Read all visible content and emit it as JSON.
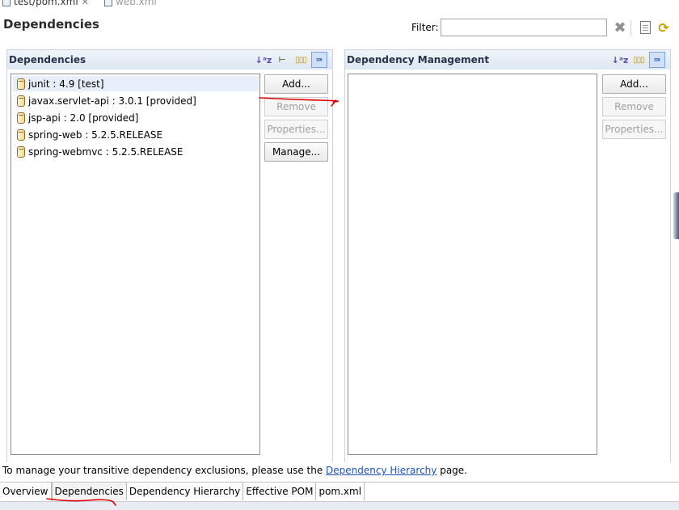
{
  "editor_tabs": [
    {
      "label": "test/pom.xml",
      "close": "✕"
    },
    {
      "label": "web.xml"
    }
  ],
  "page_title": "Dependencies",
  "filter": {
    "label": "Filter:",
    "value": ""
  },
  "icons": {
    "clear_filter": "clear-filter-icon",
    "show_pom": "pom-document-icon",
    "refresh": "refresh-icon"
  },
  "dependencies_section": {
    "title": "Dependencies",
    "items": [
      {
        "label": "junit : 4.9 [test]",
        "selected": true
      },
      {
        "label": "javax.servlet-api : 3.0.1 [provided]"
      },
      {
        "label": "jsp-api : 2.0 [provided]"
      },
      {
        "label": "spring-web : 5.2.5.RELEASE"
      },
      {
        "label": "spring-webmvc : 5.2.5.RELEASE"
      }
    ],
    "buttons": {
      "add": "Add...",
      "remove": "Remove",
      "properties": "Properties...",
      "manage": "Manage..."
    }
  },
  "management_section": {
    "title": "Dependency Management",
    "items": [],
    "buttons": {
      "add": "Add...",
      "remove": "Remove",
      "properties": "Properties..."
    }
  },
  "info": {
    "before": "To manage your transitive dependency exclusions, please use the ",
    "link": "Dependency Hierarchy",
    "after": " page."
  },
  "bottom_tabs": [
    "Overview",
    "Dependencies",
    "Dependency Hierarchy",
    "Effective POM",
    "pom.xml"
  ],
  "active_bottom_tab": "Dependencies",
  "colors": {
    "link": "#1d54b5",
    "header_bg": "#dde6f2",
    "annotation": "#e00000"
  }
}
